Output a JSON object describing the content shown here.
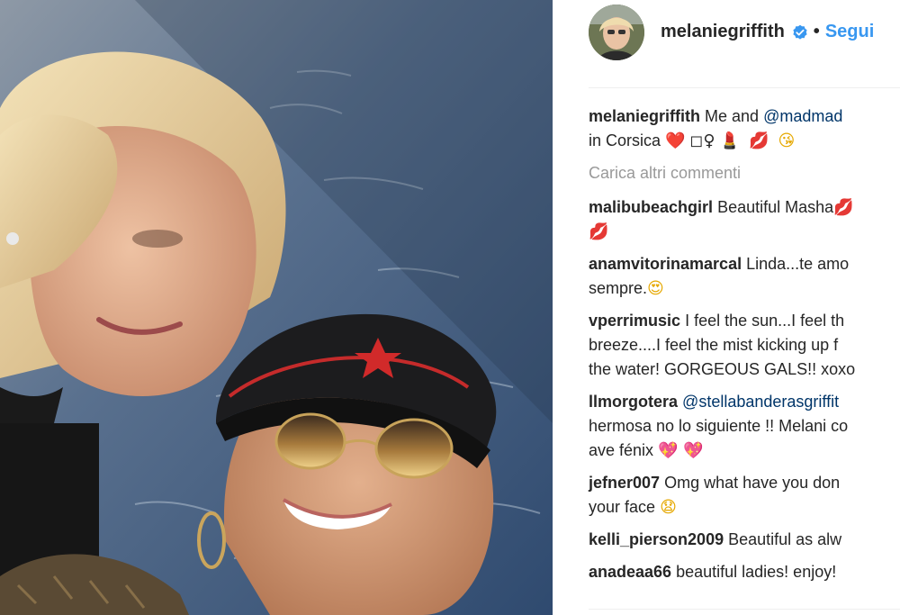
{
  "post": {
    "username": "melaniegriffith",
    "follow_label": "Segui",
    "separator": "•",
    "verified_icon": "verified-badge-icon",
    "accent_color": "#3897f0"
  },
  "caption": {
    "username": "melaniegriffith",
    "text_before": "Me and",
    "mention": "@madmad",
    "line2": "in Corsica",
    "emojis": [
      "❤️",
      "◻♀",
      "💄",
      "💋",
      "😘"
    ]
  },
  "load_more_label": "Carica altri commenti",
  "comments": [
    {
      "username": "malibubeachgirl",
      "text": "Beautiful Masha",
      "line2": "",
      "emoji_end": "💋",
      "emoji_line2": "💋"
    },
    {
      "username": "anamvitorinamarcal",
      "text": "Linda...te amo",
      "line2": "sempre.",
      "emoji_line2": "😍"
    },
    {
      "username": "vperrimusic",
      "text": "I feel the sun...I feel th",
      "line2": "breeze....I feel the mist kicking up f",
      "line3": "the water! GORGEOUS GALS!! xoxo"
    },
    {
      "username": "llmorgotera",
      "mention": "@stellabanderasgriffit",
      "line2": "hermosa no lo siguiente !! Melani co",
      "line3": "ave fénix",
      "emoji_line3": "💖 💖"
    },
    {
      "username": "jefner007",
      "text": "Omg what have you don",
      "line2": "your face",
      "emoji_line2": "😧"
    },
    {
      "username": "kelli_pierson2009",
      "text": "Beautiful as alw"
    },
    {
      "username": "anadeaa66",
      "text": "beautiful ladies! enjoy!"
    }
  ]
}
